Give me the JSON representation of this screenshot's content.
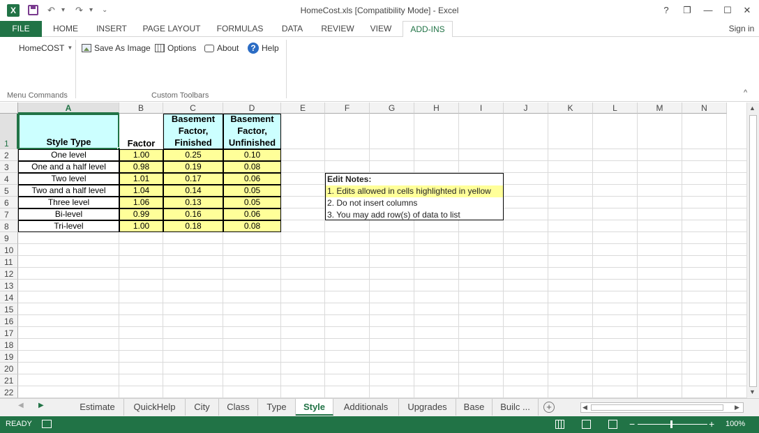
{
  "window": {
    "title": "HomeCost.xls  [Compatibility Mode] - Excel",
    "help_glyph": "?",
    "restore_glyph": "❐",
    "minimize_glyph": "—",
    "maximize_glyph": "☐",
    "close_glyph": "✕"
  },
  "qat": {
    "excel_logo": "X",
    "undo": "↶",
    "redo": "↷",
    "customize": "⌄"
  },
  "tabs": {
    "file": "FILE",
    "items": [
      "HOME",
      "INSERT",
      "PAGE LAYOUT",
      "FORMULAS",
      "DATA",
      "REVIEW",
      "VIEW",
      "ADD-INS"
    ],
    "active": "ADD-INS",
    "signin": "Sign in"
  },
  "ribbon": {
    "homecost": "HomeCOST",
    "save_as_image": "Save As Image",
    "options": "Options",
    "about": "About",
    "help": "Help",
    "group_menu": "Menu Commands",
    "group_toolbars": "Custom Toolbars",
    "collapse_glyph": "^"
  },
  "columns": [
    "A",
    "B",
    "C",
    "D",
    "E",
    "F",
    "G",
    "H",
    "I",
    "J",
    "K",
    "L",
    "M",
    "N"
  ],
  "rows": [
    "1",
    "2",
    "3",
    "4",
    "5",
    "6",
    "7",
    "8",
    "9",
    "10",
    "11",
    "12",
    "13",
    "14",
    "15",
    "16",
    "17",
    "18",
    "19",
    "20",
    "21",
    "22"
  ],
  "table": {
    "headers": {
      "style_type": "Style Type",
      "factor": "Factor",
      "basement_finished": [
        "Basement",
        "Factor,",
        "Finished"
      ],
      "basement_unfinished": [
        "Basement",
        "Factor,",
        "Unfinished"
      ]
    },
    "rows": [
      [
        "One level",
        "1.00",
        "0.25",
        "0.10"
      ],
      [
        "One and a half level",
        "0.98",
        "0.19",
        "0.08"
      ],
      [
        "Two level",
        "1.01",
        "0.17",
        "0.06"
      ],
      [
        "Two and a half level",
        "1.04",
        "0.14",
        "0.05"
      ],
      [
        "Three level",
        "1.06",
        "0.13",
        "0.05"
      ],
      [
        "Bi-level",
        "0.99",
        "0.16",
        "0.06"
      ],
      [
        "Tri-level",
        "1.00",
        "0.18",
        "0.08"
      ]
    ]
  },
  "notes": {
    "title": "Edit Notes:",
    "line1": "1. Edits allowed in cells highlighted in yellow",
    "line2": "2. Do not insert columns",
    "line3": "3. You may add row(s) of data to list"
  },
  "sheets": {
    "items": [
      "Estimate",
      "QuickHelp",
      "City",
      "Class",
      "Type",
      "Style",
      "Additionals",
      "Upgrades",
      "Base",
      "Builc ..."
    ],
    "active": "Style",
    "add_glyph": "+"
  },
  "status": {
    "ready": "READY",
    "zoom": "100%",
    "zoom_out": "−",
    "zoom_in": "+"
  },
  "colors": {
    "excel_green": "#217346",
    "yellow": "#ffff99",
    "cyan": "#ccffff"
  }
}
